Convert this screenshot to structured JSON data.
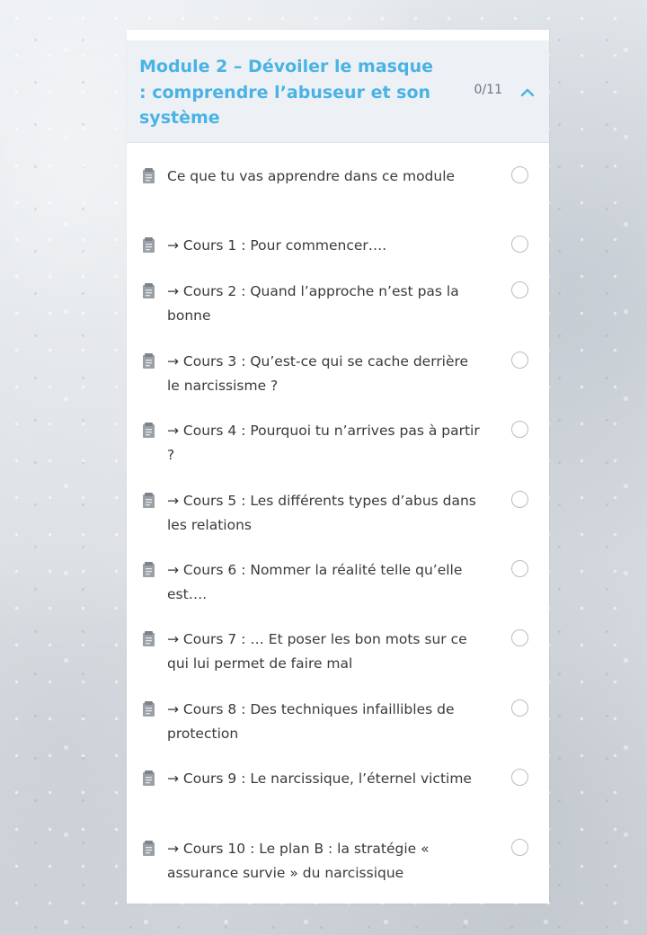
{
  "module": {
    "title": "Module 2 – Dévoiler le masque : comprendre l’abuseur et son système",
    "progress": "0/11",
    "expanded": true,
    "accent_color": "#4ab3e4",
    "toggle_icon": "chevron-up-icon"
  },
  "lessons": [
    {
      "title": "Ce que tu vas apprendre dans ce module",
      "icon": "document-icon",
      "completed": false
    },
    {
      "title": "→ Cours 1 : Pour commencer….",
      "icon": "document-icon",
      "completed": false
    },
    {
      "title": "→ Cours 2 : Quand l’approche n’est pas la bonne",
      "icon": "document-icon",
      "completed": false
    },
    {
      "title": "→ Cours 3 : Qu’est-ce qui se cache derrière le narcissisme ?",
      "icon": "document-icon",
      "completed": false
    },
    {
      "title": "→ Cours 4 : Pourquoi tu n’arrives pas à partir ?",
      "icon": "document-icon",
      "completed": false
    },
    {
      "title": "→ Cours 5 : Les différents types d’abus dans les relations",
      "icon": "document-icon",
      "completed": false
    },
    {
      "title": "→ Cours 6 : Nommer la réalité telle qu’elle est….",
      "icon": "document-icon",
      "completed": false
    },
    {
      "title": "→ Cours 7 : … Et poser les bon mots sur ce qui lui permet de faire mal",
      "icon": "document-icon",
      "completed": false
    },
    {
      "title": "→ Cours 8 : Des techniques infaillibles de protection",
      "icon": "document-icon",
      "completed": false
    },
    {
      "title": "→ Cours 9 : Le narcissique, l’éternel victime",
      "icon": "document-icon",
      "completed": false
    },
    {
      "title": "→ Cours 10 : Le plan B : la stratégie « assurance survie » du narcissique",
      "icon": "document-icon",
      "completed": false
    }
  ]
}
